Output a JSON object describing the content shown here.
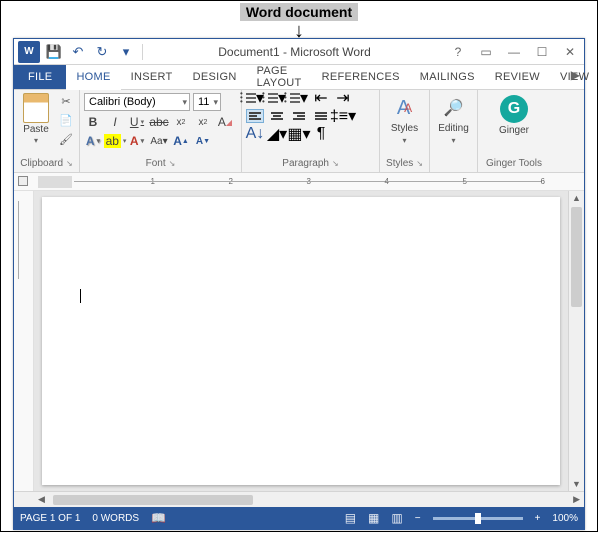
{
  "annotation": {
    "label": "Word document"
  },
  "titlebar": {
    "title": "Document1 - Microsoft Word",
    "qat_customize": "▾"
  },
  "tabs": {
    "file": "FILE",
    "items": [
      "HOME",
      "INSERT",
      "DESIGN",
      "PAGE LAYOUT",
      "REFERENCES",
      "MAILINGS",
      "REVIEW",
      "VIEW"
    ],
    "active_index": 0
  },
  "ribbon": {
    "clipboard": {
      "paste": "Paste",
      "label": "Clipboard"
    },
    "font": {
      "name": "Calibri (Body)",
      "size": "11",
      "label": "Font"
    },
    "paragraph": {
      "label": "Paragraph"
    },
    "styles": {
      "btn": "Styles",
      "label": "Styles"
    },
    "editing": {
      "btn": "Editing"
    },
    "ginger": {
      "btn": "Ginger",
      "label": "Ginger Tools"
    }
  },
  "ruler": {
    "marks": [
      "1",
      "2",
      "3",
      "4",
      "5",
      "6"
    ]
  },
  "status": {
    "page": "PAGE 1 OF 1",
    "words": "0 WORDS",
    "zoom_minus": "−",
    "zoom_plus": "+",
    "zoom": "100%"
  }
}
